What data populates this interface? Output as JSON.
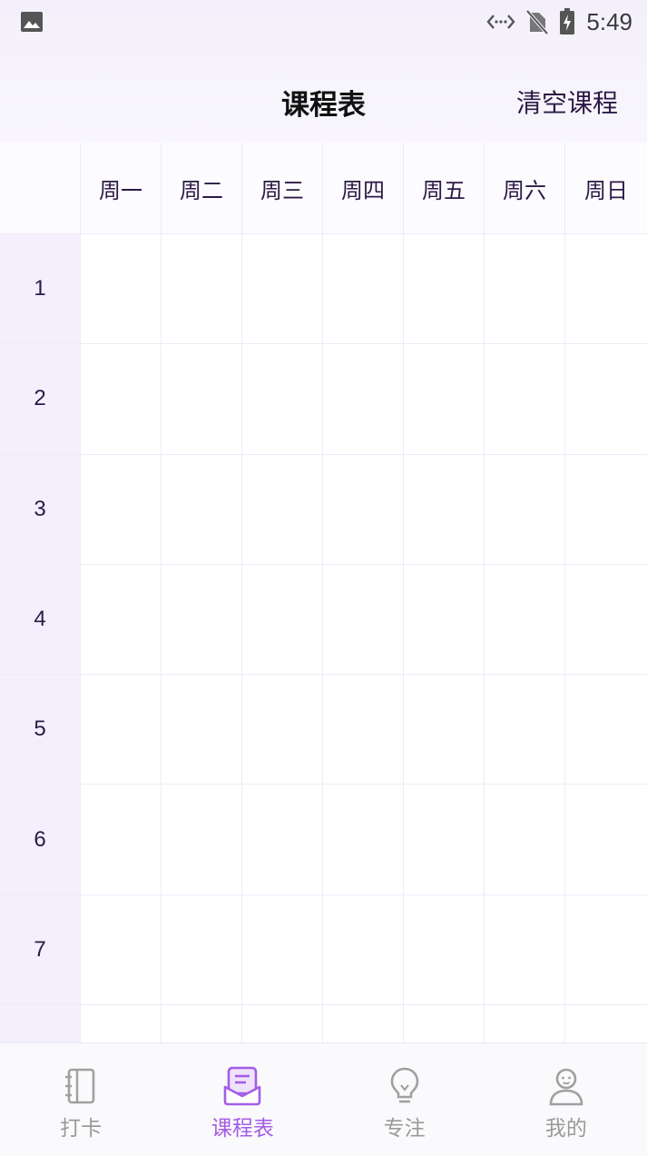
{
  "status_bar": {
    "time": "5:49",
    "left_icon": "image-icon",
    "right_icons": [
      "data-transfer-icon",
      "no-sim-icon",
      "battery-charging-icon"
    ]
  },
  "header": {
    "title": "课程表",
    "action_label": "清空课程"
  },
  "timetable": {
    "days": [
      "周一",
      "周二",
      "周三",
      "周四",
      "周五",
      "周六",
      "周日"
    ],
    "periods": [
      "1",
      "2",
      "3",
      "4",
      "5",
      "6",
      "7",
      ""
    ]
  },
  "bottom_nav": {
    "items": [
      {
        "label": "打卡",
        "icon": "notebook-icon",
        "active": false
      },
      {
        "label": "课程表",
        "icon": "schedule-icon",
        "active": true
      },
      {
        "label": "专注",
        "icon": "lightbulb-icon",
        "active": false
      },
      {
        "label": "我的",
        "icon": "user-icon",
        "active": false
      }
    ]
  },
  "colors": {
    "accent": "#a45de6",
    "period_column_bg": "#f3effc",
    "grid_line": "#efeaf8",
    "nav_inactive": "#9a9a9a"
  }
}
